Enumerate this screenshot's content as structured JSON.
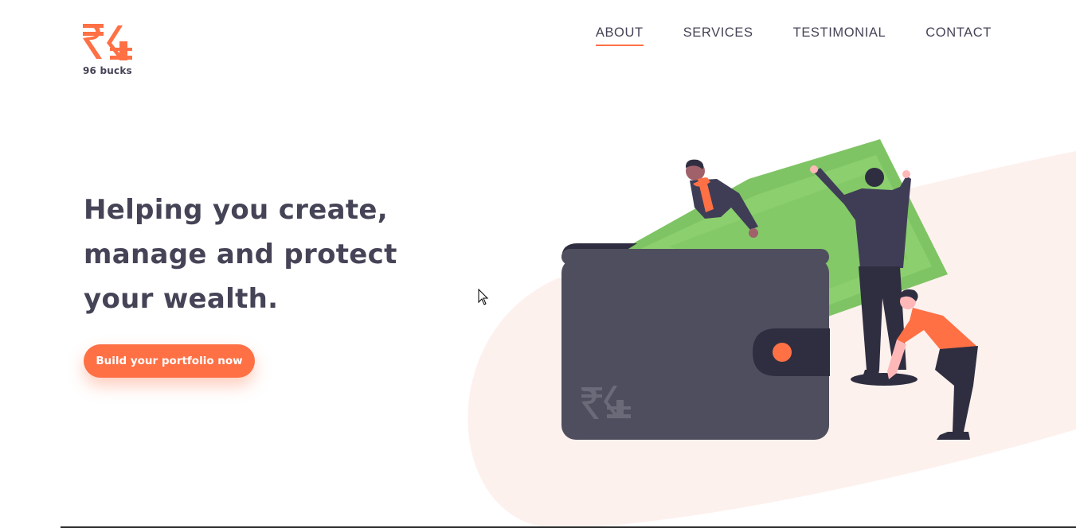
{
  "brand": {
    "name": "96 bucks",
    "logo_icon": "rupee-dollar-logo-icon",
    "accent_color": "#ff7045"
  },
  "nav": {
    "items": [
      {
        "label": "ABOUT",
        "active": true
      },
      {
        "label": "SERVICES",
        "active": false
      },
      {
        "label": "TESTIMONIAL",
        "active": false
      },
      {
        "label": "CONTACT",
        "active": false
      }
    ]
  },
  "hero": {
    "title_lines": [
      "Helping you create,",
      "manage and protect",
      "your wealth."
    ],
    "cta_label": "Build your portfolio now",
    "illustration": "wallet-with-money-and-people-illustration"
  },
  "colors": {
    "text": "#454457",
    "accent": "#ff7045",
    "wallet": "#4f4e5e",
    "money": "#8ccf6e",
    "blob": "#fdf1ee"
  }
}
